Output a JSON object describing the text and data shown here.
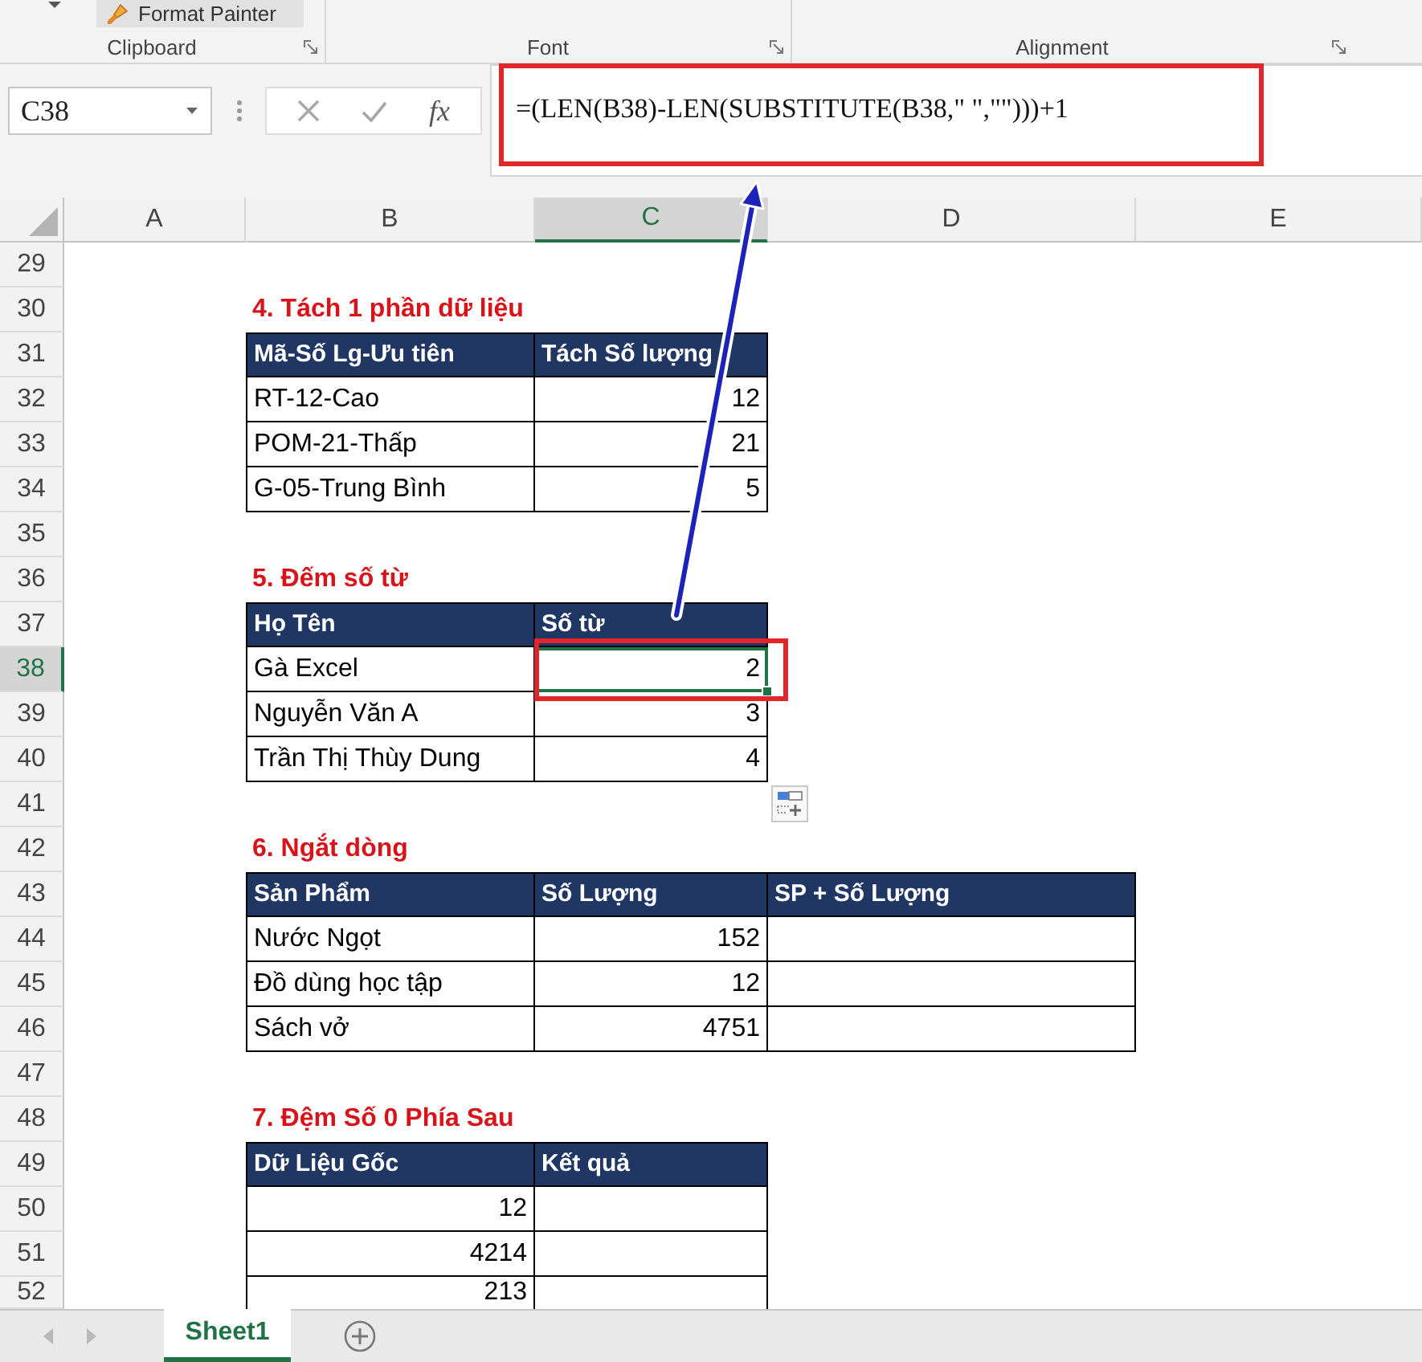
{
  "ribbon": {
    "format_painter": {
      "label": "Format Painter"
    },
    "groups": [
      {
        "label": "Clipboard"
      },
      {
        "label": "Font"
      },
      {
        "label": "Alignment"
      }
    ]
  },
  "formula_bar": {
    "name_box": "C38",
    "insert_function": "fx",
    "formula": "=(LEN(B38)-LEN(SUBSTITUTE(B38,\" \",\"\")))+1"
  },
  "sheet": {
    "columns": [
      {
        "label": "A",
        "selected": false
      },
      {
        "label": "B",
        "selected": false
      },
      {
        "label": "C",
        "selected": true
      },
      {
        "label": "D",
        "selected": false
      },
      {
        "label": "E",
        "selected": false
      }
    ],
    "rows": [
      {
        "number": "29",
        "selected": false,
        "kind": "blank"
      },
      {
        "number": "30",
        "selected": false,
        "kind": "title",
        "text": "4. Tách 1 phần dữ liệu"
      },
      {
        "number": "31",
        "selected": false,
        "kind": "header",
        "cells": [
          "Mã-Số Lg-Ưu tiên",
          "Tách Số lượng"
        ]
      },
      {
        "number": "32",
        "selected": false,
        "kind": "data",
        "cells": [
          {
            "text": "RT-12-Cao",
            "kind": "text",
            "selected": false
          },
          {
            "text": "12",
            "kind": "number",
            "selected": false
          }
        ]
      },
      {
        "number": "33",
        "selected": false,
        "kind": "data",
        "cells": [
          {
            "text": "POM-21-Thấp",
            "kind": "text",
            "selected": false
          },
          {
            "text": "21",
            "kind": "number",
            "selected": false
          }
        ]
      },
      {
        "number": "34",
        "selected": false,
        "kind": "data",
        "cells": [
          {
            "text": "G-05-Trung Bình",
            "kind": "text",
            "selected": false
          },
          {
            "text": "5",
            "kind": "number",
            "selected": false
          }
        ]
      },
      {
        "number": "35",
        "selected": false,
        "kind": "blank"
      },
      {
        "number": "36",
        "selected": false,
        "kind": "title",
        "text": "5. Đếm số từ"
      },
      {
        "number": "37",
        "selected": false,
        "kind": "header",
        "cells": [
          "Họ Tên",
          "Số từ"
        ]
      },
      {
        "number": "38",
        "selected": true,
        "kind": "data",
        "cells": [
          {
            "text": "Gà Excel",
            "kind": "text",
            "selected": false
          },
          {
            "text": "2",
            "kind": "number",
            "selected": true
          }
        ]
      },
      {
        "number": "39",
        "selected": false,
        "kind": "data",
        "cells": [
          {
            "text": "Nguyễn Văn A",
            "kind": "text",
            "selected": false
          },
          {
            "text": "3",
            "kind": "number",
            "selected": false
          }
        ]
      },
      {
        "number": "40",
        "selected": false,
        "kind": "data",
        "cells": [
          {
            "text": "Trần Thị Thùy Dung",
            "kind": "text",
            "selected": false
          },
          {
            "text": "4",
            "kind": "number",
            "selected": false
          }
        ]
      },
      {
        "number": "41",
        "selected": false,
        "kind": "blank"
      },
      {
        "number": "42",
        "selected": false,
        "kind": "title",
        "text": "6. Ngắt dòng"
      },
      {
        "number": "43",
        "selected": false,
        "kind": "header",
        "cells": [
          "Sản Phẩm",
          "Số Lượng",
          "SP + Số Lượng"
        ]
      },
      {
        "number": "44",
        "selected": false,
        "kind": "data",
        "cells": [
          {
            "text": "Nước Ngọt",
            "kind": "text",
            "selected": false
          },
          {
            "text": "152",
            "kind": "number",
            "selected": false
          },
          {
            "selected": false
          }
        ]
      },
      {
        "number": "45",
        "selected": false,
        "kind": "data",
        "cells": [
          {
            "text": "Đồ dùng học tập",
            "kind": "text",
            "selected": false
          },
          {
            "text": "12",
            "kind": "number",
            "selected": false
          },
          {
            "selected": false
          }
        ]
      },
      {
        "number": "46",
        "selected": false,
        "kind": "data",
        "cells": [
          {
            "text": "Sách vở",
            "kind": "text",
            "selected": false
          },
          {
            "text": "4751",
            "kind": "number",
            "selected": false
          },
          {
            "selected": false
          }
        ]
      },
      {
        "number": "47",
        "selected": false,
        "kind": "blank"
      },
      {
        "number": "48",
        "selected": false,
        "kind": "title",
        "text": "7. Đệm Số 0 Phía Sau"
      },
      {
        "number": "49",
        "selected": false,
        "kind": "header",
        "cells": [
          "Dữ Liệu Gốc",
          "Kết quả"
        ]
      },
      {
        "number": "50",
        "selected": false,
        "kind": "data",
        "cells": [
          {
            "text": "12",
            "kind": "number",
            "selected": false
          },
          {
            "selected": false
          }
        ]
      },
      {
        "number": "51",
        "selected": false,
        "kind": "data",
        "cells": [
          {
            "text": "4214",
            "kind": "number",
            "selected": false
          },
          {
            "selected": false
          }
        ]
      },
      {
        "number": "52",
        "selected": false,
        "kind": "data",
        "cells": [
          {
            "text": "213",
            "kind": "number",
            "selected": false
          },
          {
            "selected": false
          }
        ]
      }
    ]
  },
  "sheet_tabs": {
    "scroll_buttons": [
      {
        "disabled": true
      },
      {
        "disabled": true
      }
    ],
    "tabs": [
      {
        "label": "Sheet1",
        "selected": true
      }
    ]
  }
}
